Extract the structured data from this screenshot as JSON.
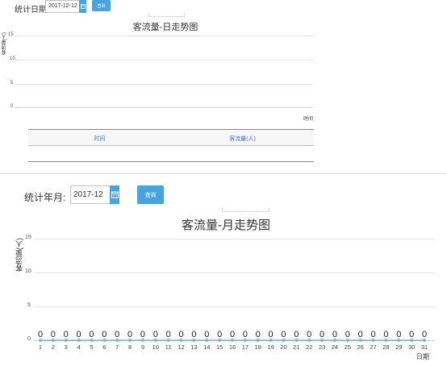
{
  "daily": {
    "date_label": "统计日期:",
    "date_value": "2017-12-12",
    "query_label": "查询",
    "chart_data": {
      "type": "line",
      "title": "客流量-日走势图",
      "ylabel": "客流量(人)",
      "xlabel": "时间",
      "ylim": [
        0,
        15
      ],
      "yticks": [
        "15",
        "10",
        "5",
        "0"
      ],
      "x": [],
      "series": []
    },
    "table": {
      "columns": [
        "时间",
        "客流量(人)"
      ],
      "rows": []
    }
  },
  "monthly": {
    "month_label": "统计年月:",
    "month_value": "2017-12",
    "query_label": "查询",
    "chart_data": {
      "type": "line",
      "title": "客流量-月走势图",
      "ylabel": "客流量(人)",
      "xlabel": "日期",
      "ylim": [
        0,
        15
      ],
      "yticks": [
        "15",
        "10",
        "5",
        "0"
      ],
      "x": [
        "1",
        "2",
        "3",
        "4",
        "5",
        "6",
        "7",
        "8",
        "9",
        "10",
        "11",
        "12",
        "13",
        "14",
        "15",
        "16",
        "17",
        "18",
        "19",
        "20",
        "21",
        "22",
        "23",
        "24",
        "25",
        "26",
        "27",
        "28",
        "29",
        "30",
        "31"
      ],
      "series": [
        {
          "values": [
            0,
            0,
            0,
            0,
            0,
            0,
            0,
            0,
            0,
            0,
            0,
            0,
            0,
            0,
            0,
            0,
            0,
            0,
            0,
            0,
            0,
            0,
            0,
            0,
            0,
            0,
            0,
            0,
            0,
            0,
            0
          ]
        }
      ],
      "line_color": "#7cb5ec"
    }
  },
  "icons": {
    "calendar": "calendar-icon",
    "collapse": "collapse-handle-icon"
  },
  "colors": {
    "accent": "#4aa3df",
    "header_link": "#3a76c4",
    "grid": "#e6e6e6"
  }
}
